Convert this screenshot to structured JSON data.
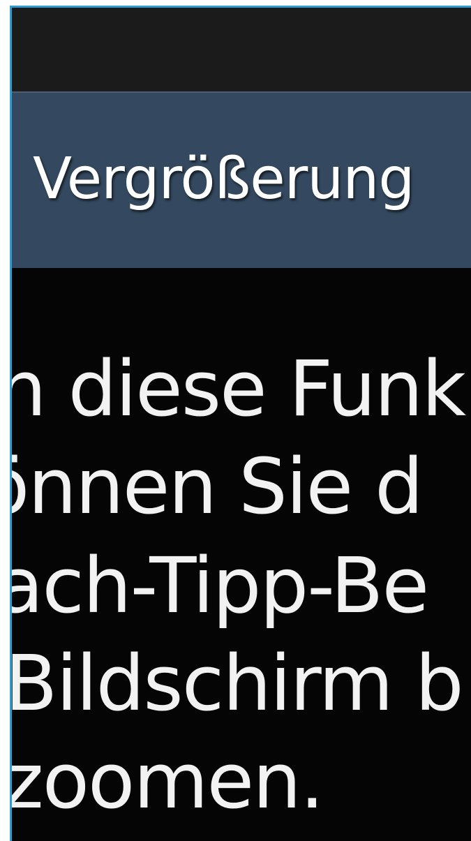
{
  "action_bar": {
    "title": "Vergrößerung"
  },
  "description": {
    "lines": [
      "n diese Funk",
      "önnen Sie d",
      "ach-Tipp-Be",
      " Bildschirm b",
      "zoomen."
    ]
  }
}
